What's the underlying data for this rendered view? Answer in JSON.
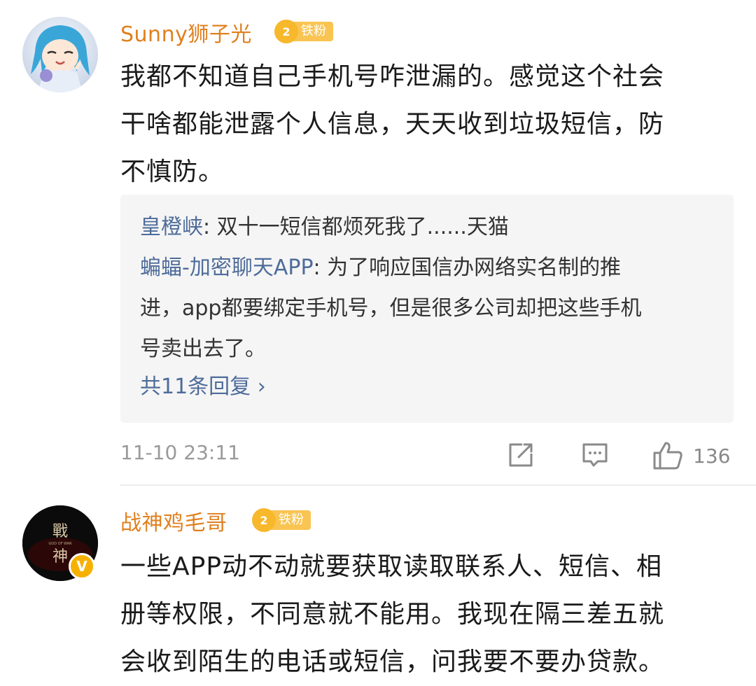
{
  "comments": [
    {
      "username": "Sunny狮子光",
      "fan_level": "2",
      "fan_label": "铁粉",
      "text_lines": [
        "我都不知道自己手机号咋泄漏的。感觉这个社会",
        "干啥都能泄露个人信息，天天收到垃圾短信，防",
        "不慎防。"
      ],
      "replies": [
        {
          "name": "皇橙峡",
          "text": ": 双十一短信都烦死我了......天猫"
        },
        {
          "name": "蝙蝠-加密聊天APP",
          "text_lines": [
            ": 为了响应国信办网络实名制的推",
            "进，app都要绑定手机号，但是很多公司却把这些手机",
            "号卖出去了。"
          ]
        }
      ],
      "more_replies": "共11条回复 ›",
      "timestamp": "11-10 23:11",
      "likes": "136",
      "icons": [
        "share-icon",
        "comment-icon",
        "like-icon"
      ]
    },
    {
      "username": "战神鸡毛哥",
      "fan_level": "2",
      "fan_label": "铁粉",
      "avatar_text": [
        "戰",
        "神"
      ],
      "avatar_subtext": "GOD OF WAR",
      "verified_mark": "V",
      "text_lines": [
        "一些APP动不动就要获取读取联系人、短信、相",
        "册等权限，不同意就不能用。我现在隔三差五就",
        "会收到陌生的电话或短信，问我要不要办贷款。"
      ]
    }
  ],
  "colors": {
    "username": "#e0801f",
    "reply_name": "#4e6c9a",
    "badge": "#f9c451",
    "meta": "#9a9a9a"
  }
}
